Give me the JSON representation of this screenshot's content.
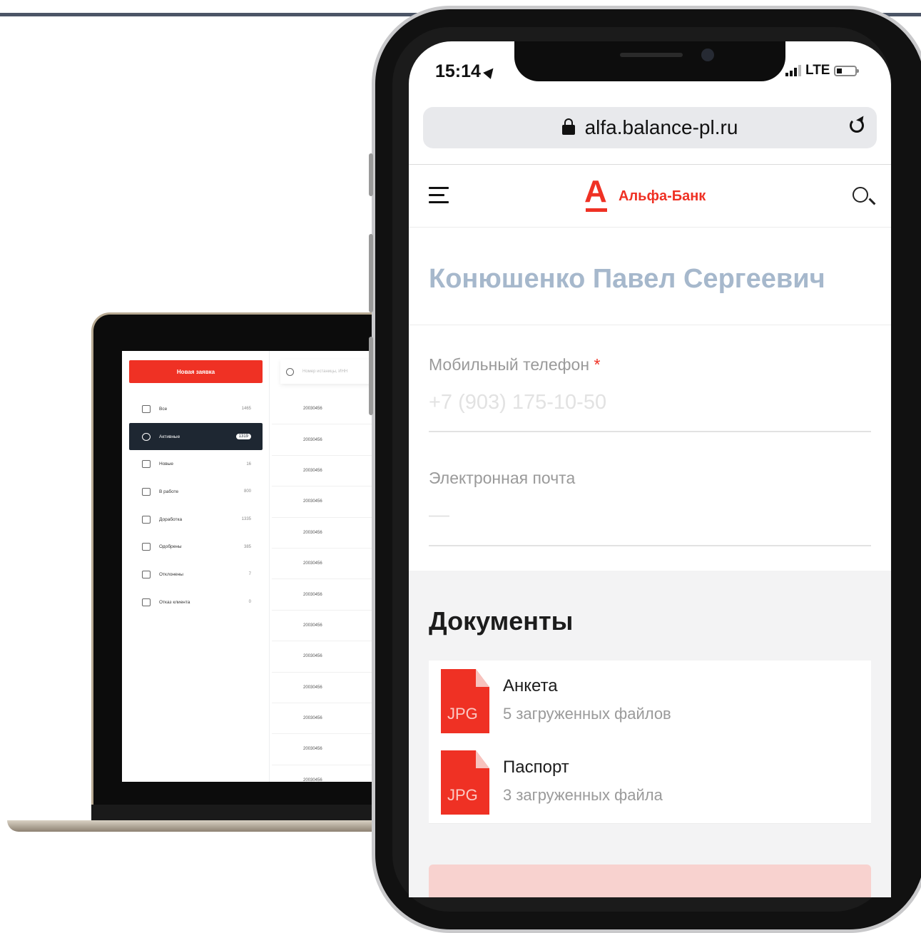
{
  "laptop": {
    "new_request_label": "Новая заявка",
    "search_placeholder": "Номер истаницы, ИНН",
    "nav": [
      {
        "label": "Все",
        "count": "1465"
      },
      {
        "label": "Активные",
        "count": "1319"
      },
      {
        "label": "Новые",
        "count": "16"
      },
      {
        "label": "В работе",
        "count": "800"
      },
      {
        "label": "Доработка",
        "count": "1335"
      },
      {
        "label": "Одобрены",
        "count": "385"
      },
      {
        "label": "Отклонены",
        "count": "7"
      },
      {
        "label": "Отказ клиента",
        "count": "0"
      }
    ],
    "rows": [
      "20030456",
      "20030456",
      "20030456",
      "20030456",
      "20030456",
      "20030456",
      "20030456",
      "20030456",
      "20030456",
      "20030456",
      "20030456",
      "20030456",
      "20030456"
    ]
  },
  "phone": {
    "status": {
      "time": "15:14",
      "network": "LTE"
    },
    "browser": {
      "url": "alfa.balance-pl.ru"
    },
    "header": {
      "logo_text": "Альфа-Банк",
      "logo_letter": "А"
    },
    "client": {
      "name": "Конюшенко Павел Сергеевич"
    },
    "fields": [
      {
        "label": "Мобильный телефон",
        "required_mark": "*",
        "value": "+7 (903) 175-10-50"
      },
      {
        "label": "Электронная почта",
        "value": "—"
      }
    ],
    "documents": {
      "title": "Документы",
      "items": [
        {
          "name": "Анкета",
          "ext": "JPG",
          "subtitle": "5 загруженных файлов"
        },
        {
          "name": "Паспорт",
          "ext": "JPG",
          "subtitle": "3 загруженных файла"
        }
      ]
    }
  },
  "colors": {
    "brand": "#ef3124",
    "name_text": "#a6b8cc",
    "laptop_active": "#1e2732"
  }
}
